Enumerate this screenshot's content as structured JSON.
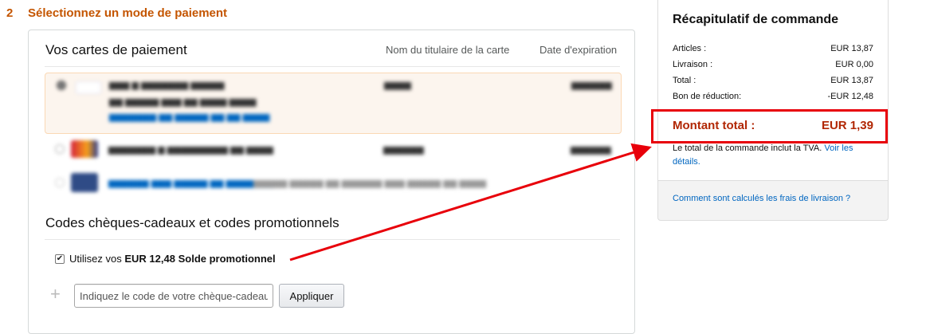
{
  "step": {
    "number": "2",
    "title": "Sélectionnez un mode de paiement"
  },
  "payment": {
    "section_title": "Vos cartes de paiement",
    "col_holder": "Nom du titulaire de la carte",
    "col_expiration": "Date d'expiration"
  },
  "promo": {
    "section_title": "Codes chèques-cadeaux et codes promotionnels",
    "use_prefix": "Utilisez vos",
    "use_amount": "EUR 12,48",
    "use_suffix": "Solde promotionnel",
    "use_checked": true,
    "input_placeholder": "Indiquez le code de votre chèque-cadeau",
    "apply_label": "Appliquer"
  },
  "summary": {
    "title": "Récapitulatif de commande",
    "rows": [
      {
        "label": "Articles :",
        "value": "EUR 13,87"
      },
      {
        "label": "Livraison :",
        "value": "EUR 0,00"
      },
      {
        "label": "Total :",
        "value": "EUR 13,87"
      },
      {
        "label": "Bon de réduction:",
        "value": "-EUR 12,48"
      }
    ],
    "total_label": "Montant total :",
    "total_value": "EUR 1,39",
    "vat_note": "Le total de la commande inclut la TVA.",
    "vat_link": "Voir les détails.",
    "shipping_link": "Comment sont calculés les frais de livraison ?"
  },
  "colors": {
    "accent": "#c45500",
    "price": "#b12704",
    "link": "#0066c0",
    "annotation": "#e8000a"
  }
}
